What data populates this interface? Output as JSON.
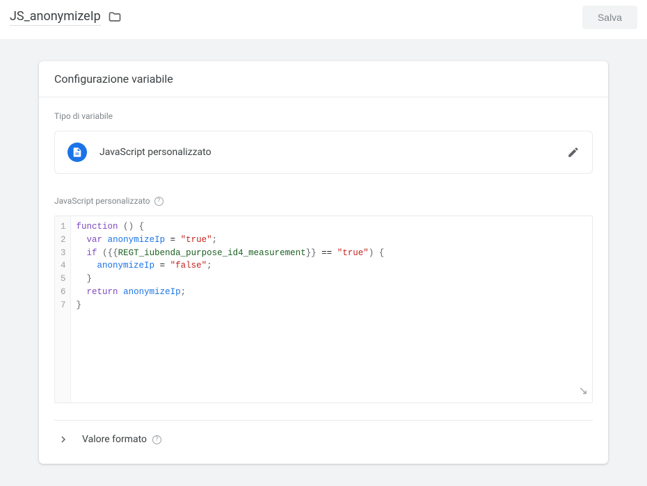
{
  "header": {
    "variable_name": "JS_anonymizeIp",
    "save_label": "Salva"
  },
  "card": {
    "title": "Configurazione variabile",
    "type_section_label": "Tipo di variabile",
    "variable_type": "JavaScript personalizzato",
    "code_section_label": "JavaScript personalizzato",
    "format_label": "Valore formato"
  },
  "code": {
    "lines": [
      "function () {",
      "  var anonymizeIp = \"true\";",
      "  if ({{REGT_iubenda_purpose_id4_measurement}} == \"true\") {",
      "    anonymizeIp = \"false\";",
      "  }",
      "  return anonymizeIp;",
      "}"
    ]
  }
}
